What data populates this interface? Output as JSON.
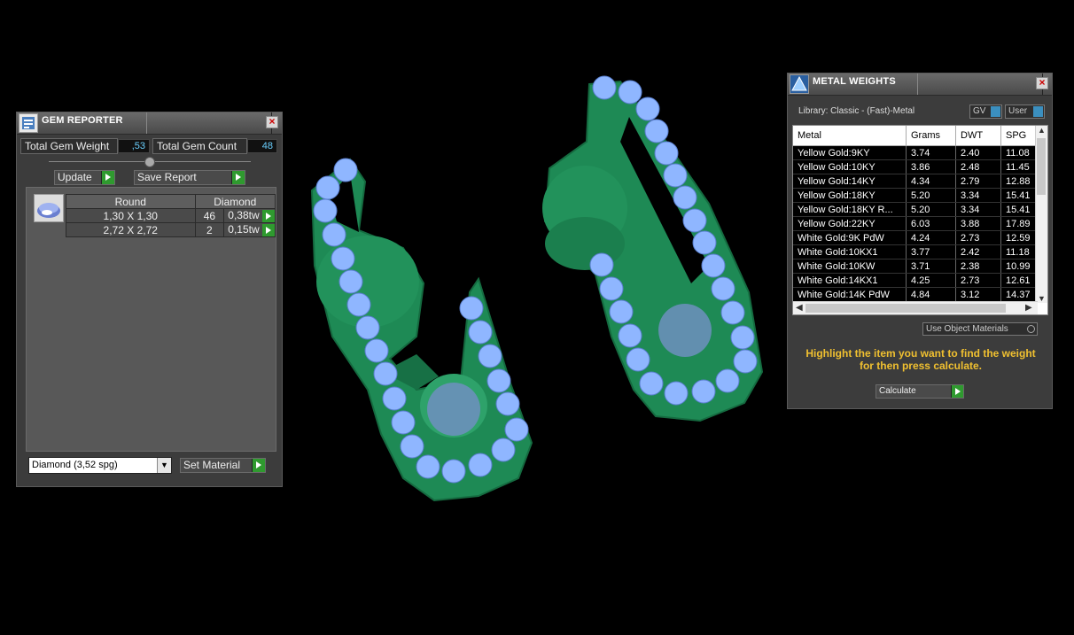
{
  "gem_reporter": {
    "title": "GEM REPORTER",
    "total_weight_label": "Total Gem Weight",
    "total_weight_value": ",53",
    "total_count_label": "Total Gem Count",
    "total_count_value": "48",
    "update_label": "Update",
    "save_report_label": "Save Report",
    "table": {
      "headers": [
        "Round",
        "Diamond"
      ],
      "rows": [
        {
          "size": "1,30 X 1,30",
          "count": "46",
          "tw": "0,38tw"
        },
        {
          "size": "2,72 X 2,72",
          "count": "2",
          "tw": "0,15tw"
        }
      ]
    },
    "material_select": "Diamond    (3,52 spg)",
    "set_material_label": "Set Material",
    "close_symbol": "×"
  },
  "metal_weights": {
    "title": "METAL WEIGHTS",
    "library": "Library: Classic - (Fast)-Metal",
    "toggle_gv": "GV",
    "toggle_user": "User",
    "columns": [
      "Metal",
      "Grams",
      "DWT",
      "SPG"
    ],
    "rows": [
      [
        "Yellow Gold:9KY",
        "3.74",
        "2.40",
        "11.08"
      ],
      [
        "Yellow Gold:10KY",
        "3.86",
        "2.48",
        "11.45"
      ],
      [
        "Yellow Gold:14KY",
        "4.34",
        "2.79",
        "12.88"
      ],
      [
        "Yellow Gold:18KY",
        "5.20",
        "3.34",
        "15.41"
      ],
      [
        "Yellow Gold:18KY R...",
        "5.20",
        "3.34",
        "15.41"
      ],
      [
        "Yellow Gold:22KY",
        "6.03",
        "3.88",
        "17.89"
      ],
      [
        "White Gold:9K PdW",
        "4.24",
        "2.73",
        "12.59"
      ],
      [
        "White Gold:10KX1",
        "3.77",
        "2.42",
        "11.18"
      ],
      [
        "White Gold:10KW",
        "3.71",
        "2.38",
        "10.99"
      ],
      [
        "White Gold:14KX1",
        "4.25",
        "2.73",
        "12.61"
      ],
      [
        "White Gold:14K PdW",
        "4.84",
        "3.12",
        "14.37"
      ]
    ],
    "use_object_materials": "Use Object Materials",
    "hint_line1": "Highlight the item you want to find the weight",
    "hint_line2": "for then press calculate.",
    "calculate_label": "Calculate",
    "close_symbol": "×"
  },
  "colors": {
    "model_green": "#1e8a55",
    "gem_blue": "#8fb6ff",
    "hint_yellow": "#f0c030",
    "accept_green": "#2f9a2f"
  }
}
